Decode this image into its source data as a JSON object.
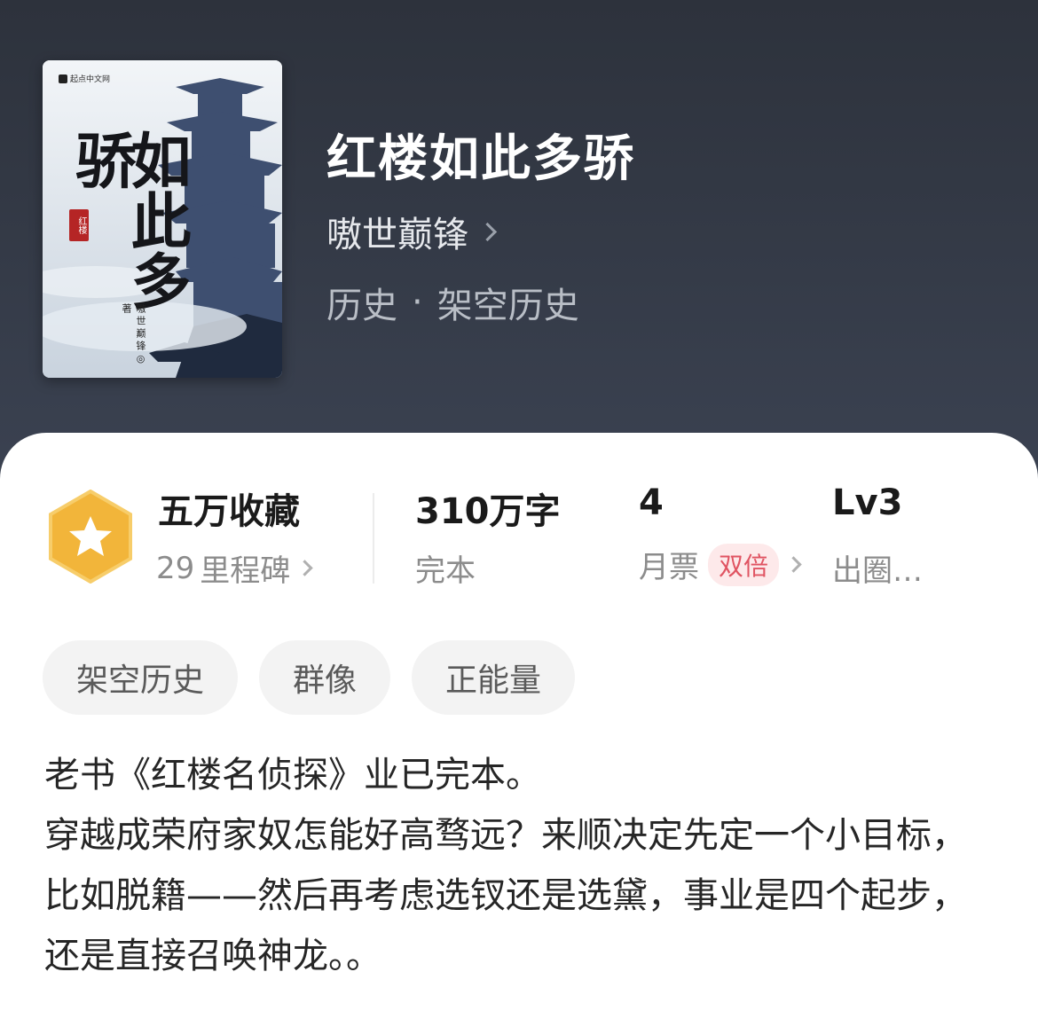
{
  "book": {
    "title": "红楼如此多骄",
    "author": "嗷世巅锋",
    "category_main": "历史",
    "category_separator": "·",
    "category_sub": "架空历史"
  },
  "cover": {
    "publisher": "起点中文网",
    "title_chars": "如此多骄",
    "seal_text": "红楼",
    "author_text": "嗷世巅锋◎著"
  },
  "stats": {
    "collection": {
      "main": "五万收藏",
      "sub_count": "29",
      "sub_label": "里程碑"
    },
    "words": {
      "main": "310万字",
      "sub": "完本"
    },
    "monthly_ticket": {
      "main": "4",
      "sub": "月票",
      "badge": "双倍"
    },
    "level": {
      "main": "Lv3",
      "sub": "出圈…"
    }
  },
  "tags": [
    "架空历史",
    "群像",
    "正能量"
  ],
  "synopsis": [
    "老书《红楼名侦探》业已完本。",
    "穿越成荣府家奴怎能好高骛远？来顺决定先定一个小目标，比如脱籍——然后再考虑选钗还是选黛，事业是四个起步，还是直接召唤神龙。。"
  ],
  "colors": {
    "header_bg": "#2d323c",
    "badge_gold": "#f2b53a",
    "double_text": "#e05462"
  }
}
